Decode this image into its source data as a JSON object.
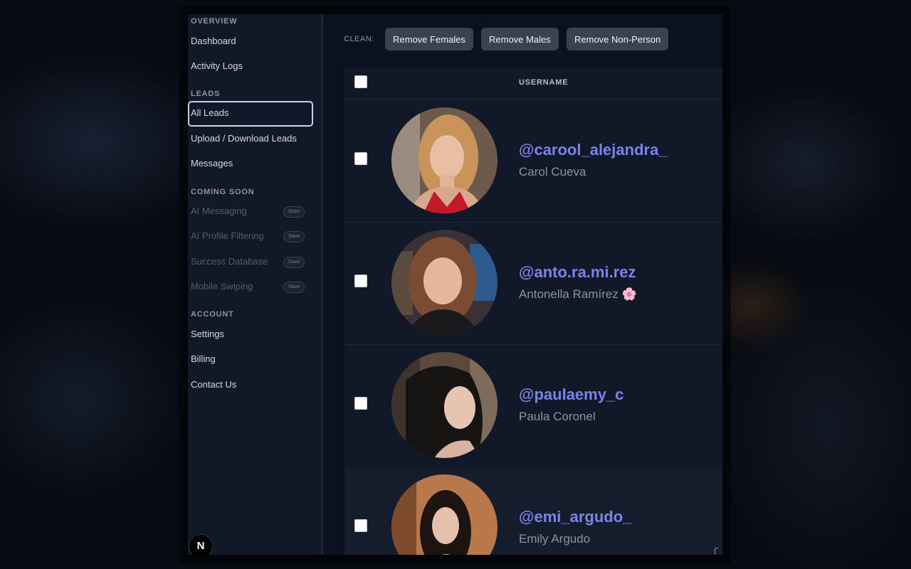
{
  "sidebar": {
    "sections": {
      "overview": "OVERVIEW",
      "leads": "LEADS",
      "coming_soon": "COMING SOON",
      "account": "ACCOUNT"
    },
    "items": {
      "dashboard": "Dashboard",
      "activity_logs": "Activity Logs",
      "all_leads": "All Leads",
      "upload_download": "Upload / Download Leads",
      "messages": "Messages",
      "ai_messaging": "AI Messaging",
      "ai_profile_filtering": "AI Profile Filtering",
      "success_database": "Success Database",
      "mobile_swiping": "Mobile Swiping",
      "settings": "Settings",
      "billing": "Billing",
      "contact_us": "Contact Us"
    },
    "soon_badge": "Soon",
    "logo_letter": "N"
  },
  "toolbar": {
    "clean_label": "CLEAN:",
    "remove_females": "Remove Females",
    "remove_males": "Remove Males",
    "remove_non_person": "Remove Non-Person"
  },
  "table": {
    "header_username": "USERNAME",
    "rows": [
      {
        "handle": "@carool_alejandra_",
        "name": "Carol Cueva"
      },
      {
        "handle": "@anto.ra.mi.rez",
        "name": "Antonella Ramírez 🌸"
      },
      {
        "handle": "@paulaemy_c",
        "name": "Paula Coronel"
      },
      {
        "handle": "@emi_argudo_",
        "name": "Emily Argudo"
      }
    ]
  },
  "colors": {
    "accent_handle": "#7b83ea",
    "sidebar_bg": "#111827",
    "button_bg": "#3a4252"
  }
}
